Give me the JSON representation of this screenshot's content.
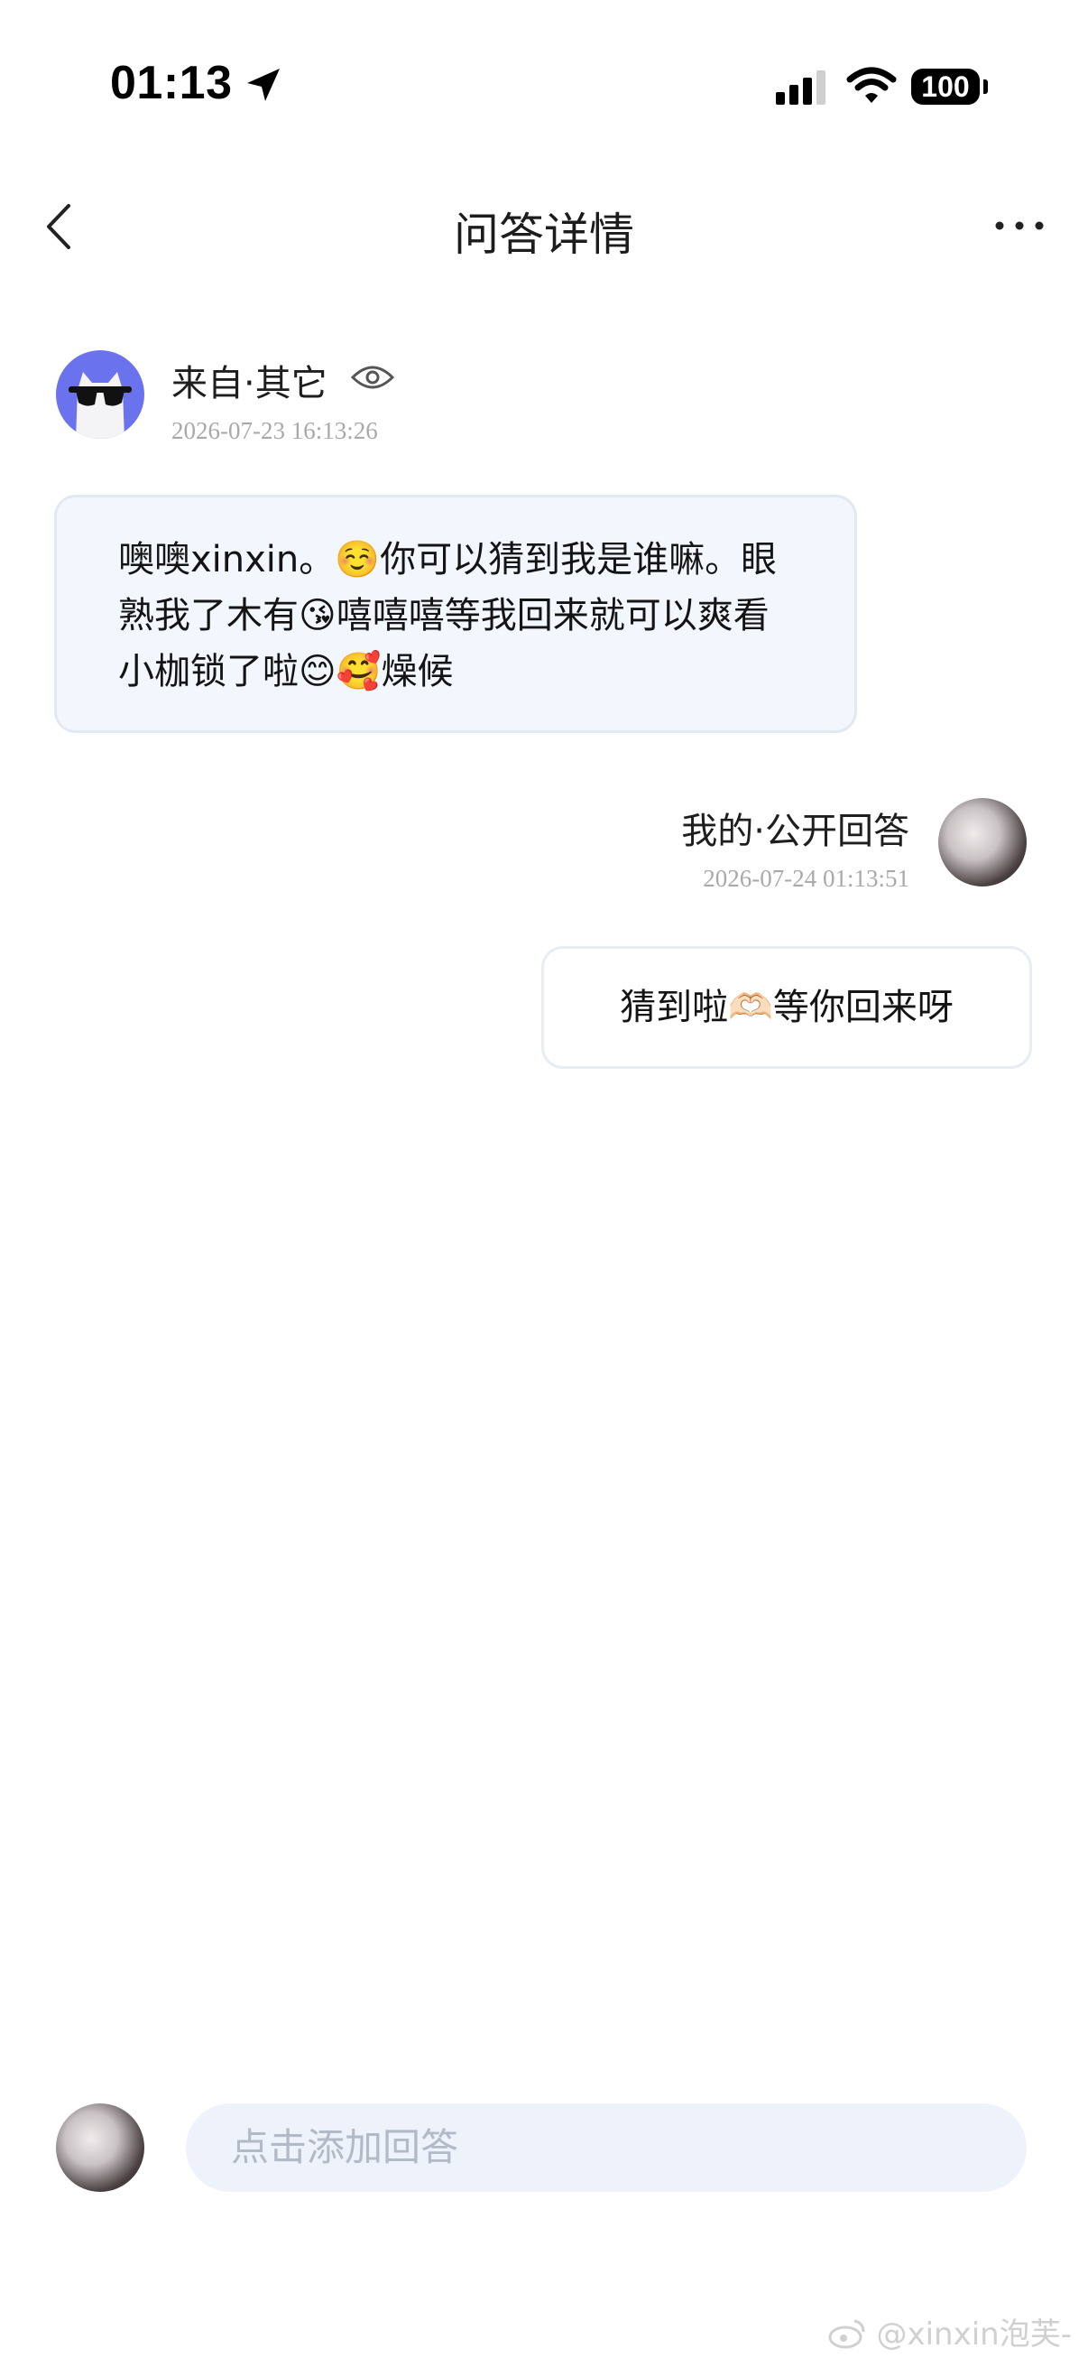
{
  "status_bar": {
    "time": "01:13",
    "battery": "100",
    "icons": [
      "location-arrow-icon",
      "cellular-signal-icon",
      "wifi-icon",
      "battery-icon"
    ]
  },
  "header": {
    "title": "问答详情",
    "back_icon": "chevron-left-icon",
    "more_icon": "more-dots-icon"
  },
  "question": {
    "source": "来自·其它",
    "visibility_icon": "eye-icon",
    "timestamp": "2026-07-23 16:13:26",
    "text": "噢噢xinxin。☺️你可以猜到我是谁嘛。眼熟我了木有😘嘻嘻嘻等我回来就可以爽看小枷锁了啦😊🥰燥候"
  },
  "answer": {
    "label": "我的·公开回答",
    "timestamp": "2026-07-24 01:13:51",
    "text": "猜到啦🫶🏻等你回来呀"
  },
  "composer": {
    "placeholder": "点击添加回答"
  },
  "watermark": {
    "text": "@xinxin泡芙-",
    "icon": "weibo-icon"
  },
  "colors": {
    "question_bubble_bg": "#f2f6fd",
    "input_bg": "#eef3fb",
    "avatar_purple": "#6b72ee",
    "timestamp_gray": "#a9a9a9"
  }
}
